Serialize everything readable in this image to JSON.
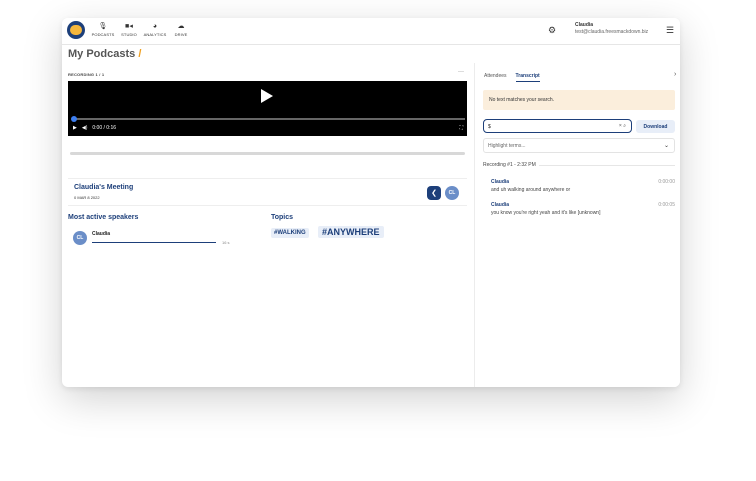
{
  "app": {
    "nav": [
      {
        "label": "PODCASTS",
        "icon": "podcast-icon",
        "glyph": "🎙"
      },
      {
        "label": "STUDIO",
        "icon": "video-camera-icon",
        "glyph": "■◂"
      },
      {
        "label": "ANALYTICS",
        "icon": "analytics-icon",
        "glyph": "◕"
      },
      {
        "label": "DRIVE",
        "icon": "cloud-icon",
        "glyph": "☁"
      }
    ],
    "user": {
      "name": "Claudia",
      "email": "test@claudia.freesmackdown.biz"
    }
  },
  "page": {
    "title": "My Podcasts",
    "separator": "/"
  },
  "recording": {
    "label": "RECORDING 1 / 1",
    "more": "···",
    "time": "0:00 / 0:16",
    "progress": 0
  },
  "meeting": {
    "title": "Claudia's Meeting",
    "date": "MAR 8 2022",
    "date_icon": "0",
    "avatar": "CL"
  },
  "speakers": {
    "heading": "Most active speakers",
    "items": [
      {
        "name": "Claudia",
        "initials": "CL",
        "duration": "16 s",
        "share": 1.0
      }
    ]
  },
  "topics": {
    "heading": "Topics",
    "tags": [
      "#WALKING",
      "#ANYWHERE"
    ]
  },
  "transcript": {
    "tabs": [
      "Attendees",
      "Transcript"
    ],
    "active_tab": "Transcript",
    "notice": "No text matches your search.",
    "search_value": "$",
    "download_label": "Download",
    "highlight_placeholder": "Highlight terms...",
    "section": "Recording #1 - 2:32 PM",
    "entries": [
      {
        "speaker": "Claudia",
        "time": "0:00:00",
        "text": "and uh walking around anywhere or"
      },
      {
        "speaker": "Claudia",
        "time": "0:00:05",
        "text": "you know you're right yeah and it's like [unknown]"
      }
    ]
  },
  "colors": {
    "brand": "#1d3f7a",
    "accent": "#f0a020",
    "notice_bg": "#fbeedc"
  }
}
